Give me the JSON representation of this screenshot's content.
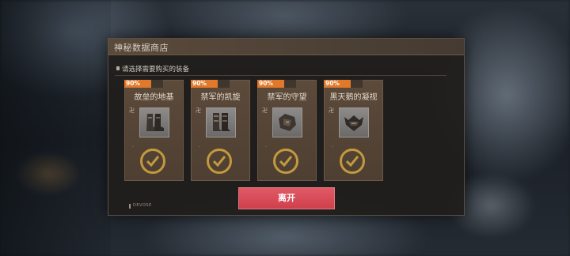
{
  "dialog": {
    "title": "神秘数据商店",
    "subtitle": "请选择需要购买的装备",
    "leave_button": "离开",
    "footer_logo": "DEVOSE"
  },
  "cards": [
    {
      "discount": "90%",
      "name": "故垒的地基",
      "icon": "boots-icon",
      "mark": "卍"
    },
    {
      "discount": "90%",
      "name": "禁军的凯旋",
      "icon": "greaves-icon",
      "mark": "卍"
    },
    {
      "discount": "90%",
      "name": "禁军的守望",
      "icon": "gauntlet-icon",
      "mark": "卍"
    },
    {
      "discount": "90%",
      "name": "黑天鹅的凝视",
      "icon": "helmet-icon",
      "mark": "卍"
    }
  ],
  "colors": {
    "accent_orange": "#e1782a",
    "check_gold": "#c29a3d",
    "leave_red": "#d84b57"
  }
}
